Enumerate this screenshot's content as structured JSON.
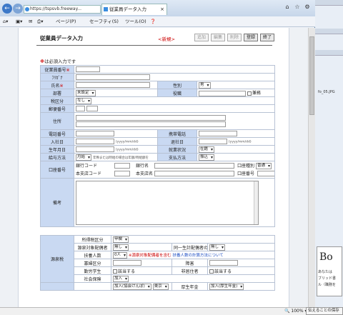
{
  "browser": {
    "url": "https://tspsvb.freeway...",
    "tab_title": "従業員データ入力",
    "menu": [
      "ページ(P)",
      "セーフティ(S)",
      "ツール(O)",
      "❓"
    ]
  },
  "page": {
    "title": "従業員データ入力",
    "mode_label": "<新規>",
    "buttons": [
      "追加",
      "編集",
      "削除",
      "登録",
      "終了"
    ],
    "required_note": "は必須入力です",
    "required_mark": "※"
  },
  "form": {
    "employee_no": "従業員番号",
    "furigana": "ﾌﾘｶﾞﾅ",
    "name": "氏名",
    "gender": "性別",
    "gender_value": "男",
    "department": "部署",
    "department_value": "未設定",
    "position": "役職",
    "concurrent": "兼務",
    "tax_class": "税区分",
    "tax_class_value": "なし",
    "postal_code": "郵便番号",
    "address": "住所",
    "phone": "電話番号",
    "mobile": "携帯電話",
    "hire_date": "入社日",
    "retire_date": "退社日",
    "date_hint": "(yyyy/mm/dd)",
    "birth_date": "生年月日",
    "employment_status": "就業状況",
    "employment_status_value": "在籍",
    "pay_method": "給与方法",
    "pay_method_value": "月給",
    "pay_method_hint": "年俸または時給の場合は年額/時給額を",
    "payment_method": "支払方法",
    "payment_method_value": "振込",
    "bank_account": "口座番号",
    "bank_code": "銀行コード",
    "bank_name": "銀行名",
    "account_type": "口座種別",
    "account_type_value": "普通",
    "branch_code": "本支店コード",
    "branch_name": "本支店名",
    "account_no": "口座番号",
    "remarks": "備考"
  },
  "tax": {
    "section": "源泉税",
    "withholding_class": "所得税区分",
    "withholding_class_value": "甲欄",
    "spouse_deduction": "源泉対象配偶者",
    "spouse_value": "無し",
    "disabled_spouse": "同一生計配偶者の障害",
    "disabled_spouse_value": "無し",
    "dependents": "扶養人数",
    "dependents_value": "0人",
    "dependents_note": "※源泉対象配偶者を含む",
    "dependents_link": "扶養人数の計算方法について",
    "widow": "寡婦区分",
    "disability": "障害",
    "student": "勤労学生",
    "student_check": "該当する",
    "nonresident": "非居住者",
    "nonresident_check": "該当する",
    "social_insurance": "社会保険",
    "social_value": "加入",
    "health_ins": "協会けんぽ",
    "health_ins_value": "加入(協会けんぽ)",
    "region": "地域",
    "region_value": "東京",
    "pension": "厚生年金",
    "pension_value": "加入(厚生年金)"
  },
  "status": {
    "zoom": "100%",
    "ime": "伝えることの保存"
  },
  "background_window": {
    "file_label": "fo_05.JPG",
    "doc_glyph": "Bo",
    "doc_text1": "あなたは",
    "doc_text2": "ブリッド書",
    "doc_text3": "ル（職務を"
  }
}
